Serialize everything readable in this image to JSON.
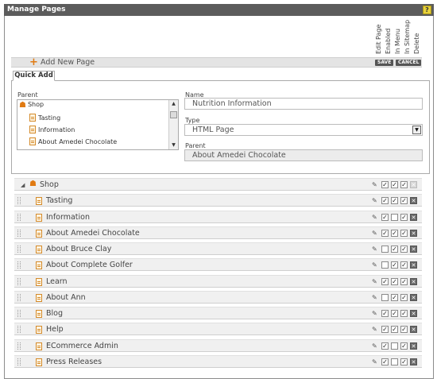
{
  "window": {
    "title": "Manage Pages",
    "help": "?"
  },
  "columns": [
    "Edit Page",
    "Enabled",
    "In Menu",
    "In Sitemap",
    "Delete"
  ],
  "add_bar": {
    "label": "Add New Page",
    "save": "SAVE",
    "cancel": "CANCEL"
  },
  "quick_add": {
    "tab": "Quick Add",
    "parent_label": "Parent",
    "tree": [
      "Shop",
      "Tasting",
      "Information",
      "About Amedei Chocolate"
    ],
    "name_label": "Name",
    "name_value": "Nutrition Information",
    "type_label": "Type",
    "type_value": "HTML Page",
    "parent_field_label": "Parent",
    "parent_value": "About Amedei Chocolate"
  },
  "pages": [
    {
      "title": "Shop",
      "icon": "home-icon",
      "enabled": true,
      "in_menu": true,
      "in_sitemap": true,
      "deletable": false
    },
    {
      "title": "Tasting",
      "icon": "page-icon",
      "enabled": true,
      "in_menu": true,
      "in_sitemap": true,
      "deletable": true
    },
    {
      "title": "Information",
      "icon": "page-icon",
      "enabled": true,
      "in_menu": false,
      "in_sitemap": true,
      "deletable": true
    },
    {
      "title": "About Amedei Chocolate",
      "icon": "page-icon",
      "enabled": true,
      "in_menu": true,
      "in_sitemap": true,
      "deletable": true
    },
    {
      "title": "About Bruce Clay",
      "icon": "page-icon",
      "enabled": false,
      "in_menu": true,
      "in_sitemap": true,
      "deletable": true
    },
    {
      "title": "About Complete Golfer",
      "icon": "page-icon",
      "enabled": false,
      "in_menu": true,
      "in_sitemap": true,
      "deletable": true
    },
    {
      "title": "Learn",
      "icon": "page-icon",
      "enabled": true,
      "in_menu": true,
      "in_sitemap": true,
      "deletable": true
    },
    {
      "title": "About Ann",
      "icon": "page-icon",
      "enabled": false,
      "in_menu": true,
      "in_sitemap": true,
      "deletable": true
    },
    {
      "title": "Blog",
      "icon": "page-icon",
      "enabled": true,
      "in_menu": true,
      "in_sitemap": true,
      "deletable": true
    },
    {
      "title": "Help",
      "icon": "page-icon",
      "enabled": true,
      "in_menu": true,
      "in_sitemap": true,
      "deletable": true
    },
    {
      "title": "ECommerce Admin",
      "icon": "page-icon",
      "enabled": true,
      "in_menu": false,
      "in_sitemap": true,
      "deletable": true
    },
    {
      "title": "Press Releases",
      "icon": "press-icon",
      "enabled": true,
      "in_menu": false,
      "in_sitemap": true,
      "deletable": true
    }
  ],
  "colors": {
    "accent": "#e07a12",
    "titlebar": "#5c5c5c",
    "row_bg": "#f0f0f0"
  }
}
